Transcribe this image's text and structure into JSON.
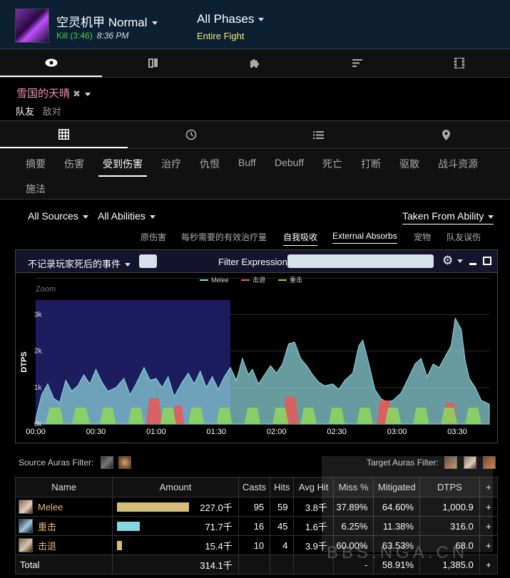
{
  "header": {
    "boss_name": "空灵机甲 Normal",
    "kill": "Kill (3:46)",
    "time": "8:36 PM",
    "phase": "All Phases",
    "phase_sub": "Entire Fight"
  },
  "player": {
    "name": "雪国的天晴",
    "friendly_tab": "队友",
    "enemy_tab": "敌对"
  },
  "categories": [
    "摘要",
    "伤害",
    "受到伤害",
    "治疗",
    "仇恨",
    "Buff",
    "Debuff",
    "死亡",
    "打断",
    "驱散",
    "战斗资源",
    "施法"
  ],
  "filters": {
    "sources": "All Sources",
    "abilities": "All Abilities",
    "view": "Taken From Ability"
  },
  "subtabs": [
    "原伤害",
    "每秒需要的有效治疗量",
    "自我吸收",
    "External Absorbs",
    "宠物",
    "队友误伤"
  ],
  "panel": {
    "death_filter": "不记录玩家死后的事件",
    "filter_label": "Filter Expression:"
  },
  "chart_data": {
    "type": "area",
    "ylabel": "DTPS",
    "zoom_label": "Zoom",
    "ylim": [
      0,
      3400
    ],
    "x_ticks": [
      "00:00",
      "00:30",
      "01:00",
      "01:30",
      "02:00",
      "02:30",
      "03:00",
      "03:30"
    ],
    "x_tick_values": [
      0,
      30,
      60,
      90,
      120,
      150,
      180,
      210
    ],
    "y_ticks": [
      "0k",
      "1k",
      "2k",
      "3k"
    ],
    "y_tick_values": [
      0,
      1000,
      2000,
      3000
    ],
    "xlim": [
      0,
      226
    ],
    "zoom_range": [
      0,
      97
    ],
    "legend": [
      "Melee",
      "击退",
      "重击"
    ],
    "colors": {
      "Melee": "#8fd7de",
      "击退": "#e35a5a",
      "重击": "#8ed460"
    },
    "series": [
      {
        "name": "Melee",
        "points": [
          [
            0,
            150
          ],
          [
            3,
            800
          ],
          [
            6,
            1100
          ],
          [
            9,
            700
          ],
          [
            12,
            600
          ],
          [
            15,
            1200
          ],
          [
            18,
            900
          ],
          [
            21,
            1050
          ],
          [
            24,
            1350
          ],
          [
            27,
            1100
          ],
          [
            30,
            1500
          ],
          [
            33,
            1150
          ],
          [
            36,
            900
          ],
          [
            40,
            1000
          ],
          [
            44,
            1250
          ],
          [
            47,
            800
          ],
          [
            50,
            1100
          ],
          [
            54,
            1550
          ],
          [
            57,
            1200
          ],
          [
            60,
            1250
          ],
          [
            63,
            1000
          ],
          [
            66,
            1300
          ],
          [
            69,
            750
          ],
          [
            73,
            1150
          ],
          [
            76,
            1400
          ],
          [
            79,
            1100
          ],
          [
            82,
            1450
          ],
          [
            85,
            1000
          ],
          [
            88,
            1300
          ],
          [
            91,
            950
          ],
          [
            94,
            1300
          ],
          [
            97,
            1550
          ],
          [
            100,
            1200
          ],
          [
            103,
            1800
          ],
          [
            106,
            1350
          ],
          [
            108,
            1500
          ],
          [
            111,
            1100
          ],
          [
            114,
            1350
          ],
          [
            117,
            1600
          ],
          [
            120,
            1400
          ],
          [
            123,
            1650
          ],
          [
            126,
            2200
          ],
          [
            129,
            2250
          ],
          [
            132,
            1800
          ],
          [
            135,
            1600
          ],
          [
            138,
            1350
          ],
          [
            141,
            1150
          ],
          [
            144,
            1050
          ],
          [
            148,
            1100
          ],
          [
            151,
            950
          ],
          [
            154,
            1200
          ],
          [
            158,
            1400
          ],
          [
            161,
            2150
          ],
          [
            163,
            2300
          ],
          [
            166,
            1650
          ],
          [
            169,
            950
          ],
          [
            172,
            700
          ],
          [
            175,
            600
          ],
          [
            178,
            650
          ],
          [
            182,
            850
          ],
          [
            186,
            1300
          ],
          [
            189,
            1650
          ],
          [
            192,
            1800
          ],
          [
            195,
            1300
          ],
          [
            198,
            1650
          ],
          [
            201,
            1550
          ],
          [
            204,
            1850
          ],
          [
            207,
            2150
          ],
          [
            209,
            2900
          ],
          [
            212,
            2600
          ],
          [
            214,
            1750
          ],
          [
            216,
            1250
          ],
          [
            219,
            1000
          ],
          [
            222,
            650
          ],
          [
            226,
            550
          ]
        ]
      },
      {
        "name": "击退",
        "bursts": [
          [
            55,
            63,
            700
          ],
          [
            68,
            74,
            500
          ],
          [
            123,
            131,
            750
          ],
          [
            170,
            178,
            650
          ],
          [
            203,
            210,
            580
          ]
        ]
      },
      {
        "name": "重击",
        "bursts": [
          [
            5,
            14,
            450
          ],
          [
            18,
            27,
            450
          ],
          [
            32,
            40,
            450
          ],
          [
            46,
            54,
            450
          ],
          [
            62,
            70,
            450
          ],
          [
            76,
            84,
            450
          ],
          [
            90,
            98,
            450
          ],
          [
            104,
            112,
            450
          ],
          [
            118,
            126,
            450
          ],
          [
            132,
            140,
            450
          ],
          [
            146,
            154,
            450
          ],
          [
            160,
            168,
            450
          ],
          [
            174,
            182,
            450
          ],
          [
            188,
            196,
            450
          ],
          [
            202,
            210,
            450
          ],
          [
            214,
            222,
            450
          ]
        ]
      }
    ]
  },
  "auras": {
    "source": "Source Auras Filter:",
    "target": "Target Auras Filter:"
  },
  "table": {
    "headers": [
      "Name",
      "Amount",
      "Casts",
      "Hits",
      "Avg Hit",
      "Miss %",
      "Mitigated",
      "DTPS",
      "+"
    ],
    "rows": [
      {
        "name": "Melee",
        "amount": "227.0千",
        "pct": 0.72,
        "casts": "95",
        "hits": "59",
        "avg": "3.8千",
        "miss": "37.89%",
        "mit": "64.60%",
        "dtps": "1,000.9",
        "bar_color": "#d4bc7a",
        "name_color": "#e7b971"
      },
      {
        "name": "重击",
        "amount": "71.7千",
        "pct": 0.23,
        "casts": "16",
        "hits": "45",
        "avg": "1.6千",
        "miss": "6.25%",
        "mit": "11.38%",
        "dtps": "316.0",
        "bar_color": "#84d6e3",
        "name_color": "#e7b971"
      },
      {
        "name": "击退",
        "amount": "15.4千",
        "pct": 0.05,
        "casts": "10",
        "hits": "4",
        "avg": "3.9千",
        "miss": "60.00%",
        "mit": "63.53%",
        "dtps": "68.0",
        "bar_color": "#d4bc7a",
        "name_color": "#e7b971"
      }
    ],
    "total": {
      "label": "Total",
      "amount": "314.1千",
      "miss": "-",
      "mit": "58.91%",
      "dtps": "1,385.0"
    },
    "plus": "+"
  },
  "watermark": "BBS.NGA.CN"
}
